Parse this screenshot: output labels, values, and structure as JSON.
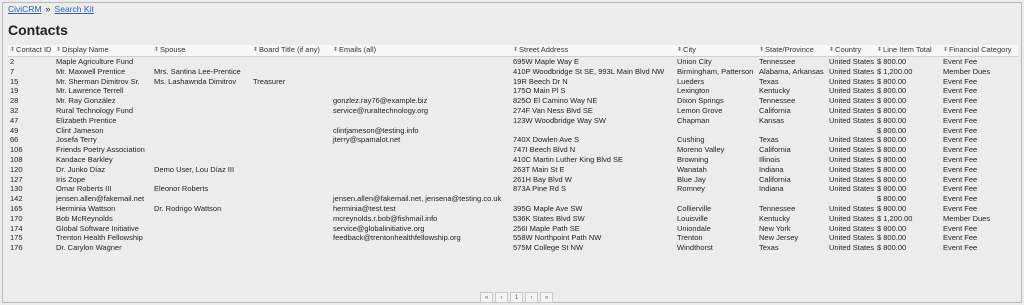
{
  "breadcrumb": {
    "home": "CiviCRM",
    "current": "Search Kit",
    "separator": "»"
  },
  "title": "Contacts",
  "columns": [
    "Contact ID",
    "Display Name",
    "Spouse",
    "Board Title (if any)",
    "Emails (all)",
    "Street Address",
    "City",
    "State/Province",
    "Country",
    "Line Item Total",
    "Financial Category"
  ],
  "rows": [
    [
      "2",
      "Maple Agriculture Fund",
      "",
      "",
      "",
      "695W Maple Way E",
      "Union City",
      "Tennessee",
      "United States",
      "$ 800.00",
      "Event Fee"
    ],
    [
      "7",
      "Mr. Maxwell Prentice",
      "Mrs. Santina Lee-Prentice",
      "",
      "",
      "410P Woodbridge St SE, 993L Main Blvd NW",
      "Birmingham, Patterson",
      "Alabama, Arkansas",
      "United States",
      "$ 1,200.00",
      "Member Dues"
    ],
    [
      "15",
      "Mr. Sherman Dimitrov Sr.",
      "Ms. Lashawnda Dimitrov",
      "Treasurer",
      "",
      "19R Beech Dr N",
      "Lueders",
      "Texas",
      "United States",
      "$ 800.00",
      "Event Fee"
    ],
    [
      "19",
      "Mr. Lawrence Terrell",
      "",
      "",
      "",
      "175O Main Pl S",
      "Lexington",
      "Kentucky",
      "United States",
      "$ 800.00",
      "Event Fee"
    ],
    [
      "28",
      "Mr. Ray González",
      "",
      "",
      "gonzlez.ray76@example.biz",
      "825O El Camino Way NE",
      "Dixon Springs",
      "Tennessee",
      "United States",
      "$ 800.00",
      "Event Fee"
    ],
    [
      "32",
      "Rural Technology Fund",
      "",
      "",
      "service@ruraltechnology.org",
      "274F Van Ness Blvd SE",
      "Lemon Grove",
      "California",
      "United States",
      "$ 800.00",
      "Event Fee"
    ],
    [
      "47",
      "Elizabeth Prentice",
      "",
      "",
      "",
      "123W Woodbridge Way SW",
      "Chapman",
      "Kansas",
      "United States",
      "$ 800.00",
      "Event Fee"
    ],
    [
      "49",
      "Clint Jameson",
      "",
      "",
      "clintjameson@testing.info",
      "",
      "",
      "",
      "",
      "$ 800.00",
      "Event Fee"
    ],
    [
      "66",
      "Josefa Terry",
      "",
      "",
      "jterry@spamalot.net",
      "740X Dowlen Ave S",
      "Cushing",
      "Texas",
      "United States",
      "$ 800.00",
      "Event Fee"
    ],
    [
      "106",
      "Friends Poetry Association",
      "",
      "",
      "",
      "747I Beech Blvd N",
      "Moreno Valley",
      "California",
      "United States",
      "$ 800.00",
      "Event Fee"
    ],
    [
      "108",
      "Kandace Barkley",
      "",
      "",
      "",
      "410C Martin Luther King Blvd SE",
      "Browning",
      "Illinois",
      "United States",
      "$ 800.00",
      "Event Fee"
    ],
    [
      "120",
      "Dr. Junko Díaz",
      "Demo User, Lou Díaz III",
      "",
      "",
      "263T Main St E",
      "Wanatah",
      "Indiana",
      "United States",
      "$ 800.00",
      "Event Fee"
    ],
    [
      "127",
      "Iris Zope",
      "",
      "",
      "",
      "261H Bay Blvd W",
      "Blue Jay",
      "California",
      "United States",
      "$ 800.00",
      "Event Fee"
    ],
    [
      "130",
      "Omar Roberts III",
      "Eleonor Roberts",
      "",
      "",
      "873A Pine Rd S",
      "Romney",
      "Indiana",
      "United States",
      "$ 800.00",
      "Event Fee"
    ],
    [
      "142",
      "jensen.allen@fakemail.net",
      "",
      "",
      "jensen.allen@fakemail.net, jensena@testing.co.uk",
      "",
      "",
      "",
      "",
      "$ 800.00",
      "Event Fee"
    ],
    [
      "165",
      "Herminia Wattson",
      "Dr. Rodrigo Wattson",
      "",
      "herminia@test.test",
      "395G Maple Ave SW",
      "Collierville",
      "Tennessee",
      "United States",
      "$ 800.00",
      "Event Fee"
    ],
    [
      "170",
      "Bob McReynolds",
      "",
      "",
      "mcreynolds.r.bob@fishmail.info",
      "536K States Blvd SW",
      "Louisville",
      "Kentucky",
      "United States",
      "$ 1,200.00",
      "Member Dues"
    ],
    [
      "174",
      "Global Software Initiative",
      "",
      "",
      "service@globalinitiative.org",
      "256I Maple Path SE",
      "Uniondale",
      "New York",
      "United States",
      "$ 800.00",
      "Event Fee"
    ],
    [
      "175",
      "Trenton Health Fellowship",
      "",
      "",
      "feedback@trentonhealthfellowship.org",
      "558W Northpoint Path NW",
      "Trenton",
      "New Jersey",
      "United States",
      "$ 800.00",
      "Event Fee"
    ],
    [
      "176",
      "Dr. Carylon Wagner",
      "",
      "",
      "",
      "575M College St NW",
      "Windthorst",
      "Texas",
      "United States",
      "$ 800.00",
      "Event Fee"
    ]
  ],
  "pager": [
    "«",
    "‹",
    "1",
    "›",
    "»"
  ],
  "colors": {
    "link": "#2b62b5",
    "background": "#ececec",
    "header": "#f7f7f7"
  }
}
